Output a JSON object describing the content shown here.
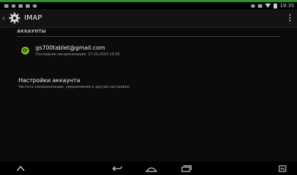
{
  "app": {
    "title": "IMAP"
  },
  "status_bar": {
    "time": "19:35"
  },
  "section": {
    "header": "АККАУНТЫ"
  },
  "account": {
    "email": "gs700tablet@gmail.com",
    "last_sync": "Последняя синхронизация: 17.10.2014 19:35"
  },
  "settings": {
    "title": "Настройки аккаунта",
    "subtitle": "Частота синхронизации, уведомления и другие настройки"
  },
  "icons": {
    "app": "gear-icon",
    "sync": "sync-icon",
    "overflow": "overflow-menu-icon",
    "nav": [
      "menu-up-icon",
      "back-icon",
      "home-icon",
      "recents-icon",
      "screenshot-icon"
    ]
  },
  "colors": {
    "accent": "#2f8f2f",
    "sync_green": "#7bbd22",
    "background": "#0b0b0b"
  }
}
